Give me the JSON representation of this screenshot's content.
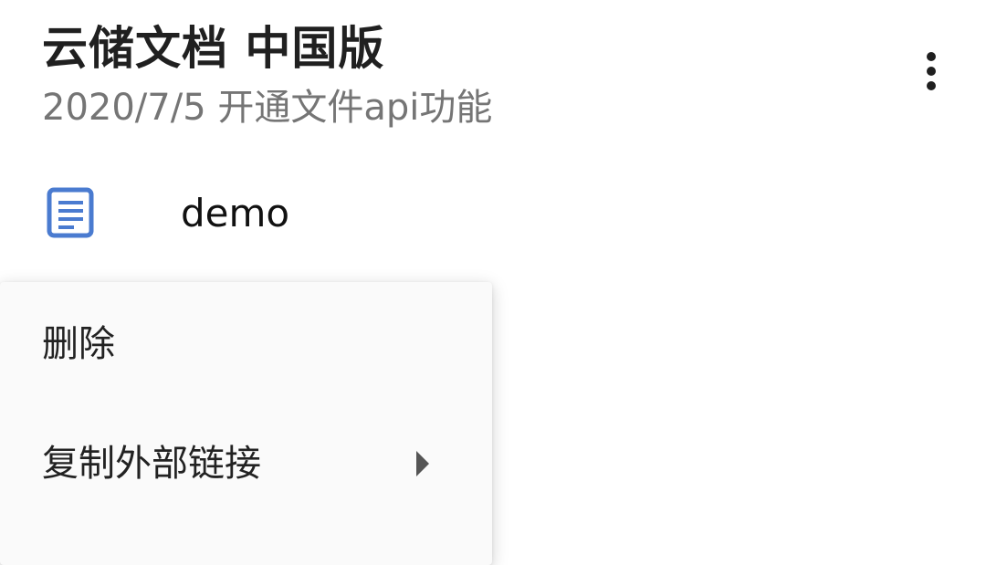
{
  "header": {
    "title": "云储文档 中国版",
    "subtitle": "2020/7/5 开通文件api功能"
  },
  "icons": {
    "overflow": "more-vert-icon",
    "document": "document-icon",
    "submenu": "chevron-right-icon"
  },
  "colors": {
    "document_icon": "#4a7bd0",
    "menu_background": "#fafafa",
    "subtitle": "#757575"
  },
  "documents": [
    {
      "name": "demo"
    }
  ],
  "context_menu": {
    "items": [
      {
        "label": "删除"
      },
      {
        "label": "复制外部链接",
        "has_submenu": true
      }
    ]
  }
}
